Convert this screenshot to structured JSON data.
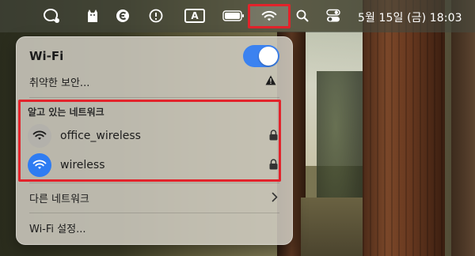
{
  "menubar": {
    "icons": [
      "chat-bubble-icon",
      "cat-icon",
      "e-logo-icon",
      "history-icon",
      "keyboard-input-icon",
      "battery-icon",
      "wifi-icon",
      "search-icon",
      "control-center-icon"
    ],
    "input_source_label": "A",
    "datetime": "5월 15일 (금) 18:03"
  },
  "wifi_panel": {
    "title": "Wi-Fi",
    "toggle_on": true,
    "security_warning": "취약한 보안...",
    "known_networks_label": "알고 있는 네트워크",
    "networks": [
      {
        "name": "office_wireless",
        "connected": false,
        "locked": true
      },
      {
        "name": "wireless",
        "connected": true,
        "locked": true
      }
    ],
    "other_networks": "다른 네트워크",
    "settings": "Wi-Fi 설정..."
  },
  "colors": {
    "accent_blue": "#3b82f0",
    "highlight_red": "#e2232b"
  }
}
